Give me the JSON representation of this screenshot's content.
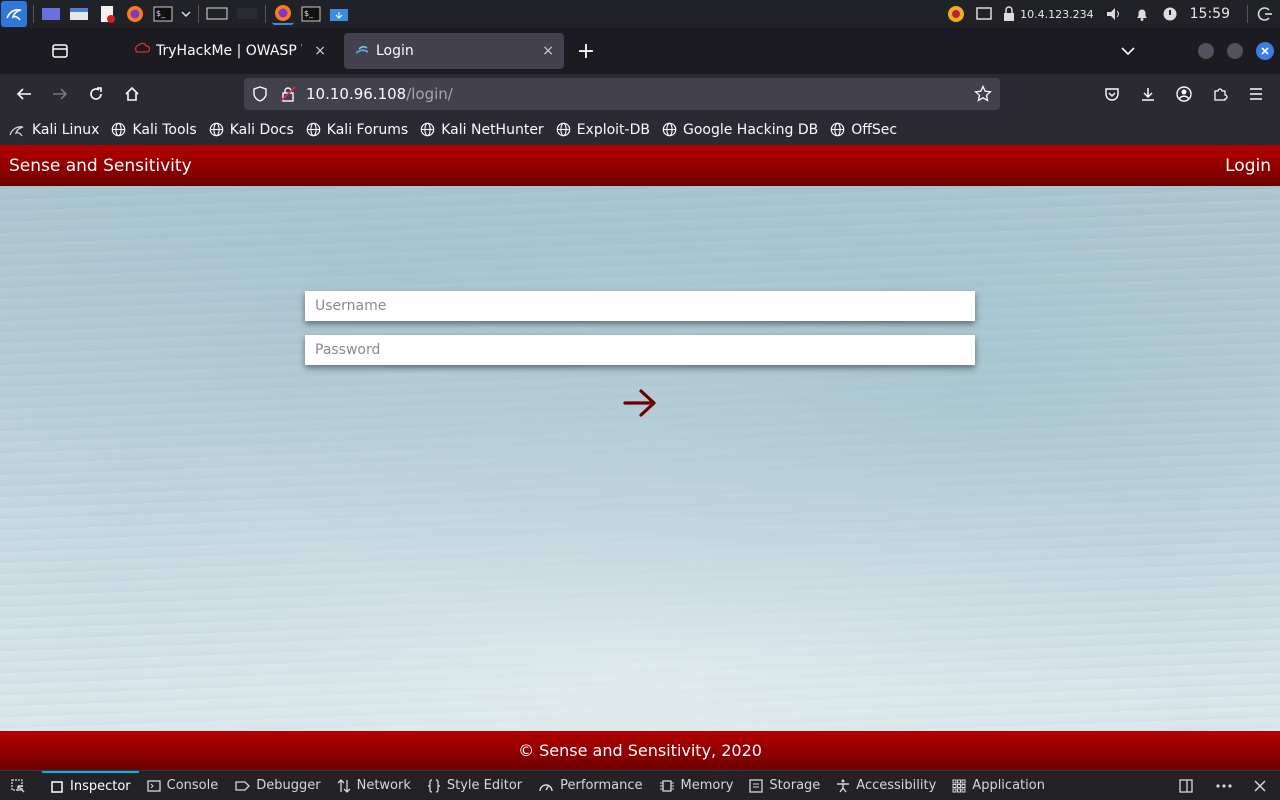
{
  "taskbar": {
    "ip": "10.4.123.234",
    "clock": "15:59"
  },
  "tabs": [
    {
      "label": "TryHackMe | OWASP Top",
      "close": "×"
    },
    {
      "label": "Login",
      "close": "×"
    }
  ],
  "new_tab": "+",
  "url": {
    "host": "10.10.96.108",
    "path": "/login/"
  },
  "bookmarks": [
    "Kali Linux",
    "Kali Tools",
    "Kali Docs",
    "Kali Forums",
    "Kali NetHunter",
    "Exploit-DB",
    "Google Hacking DB",
    "OffSec"
  ],
  "site": {
    "brand": "Sense and Sensitivity",
    "login_link": "Login",
    "username_placeholder": "Username",
    "password_placeholder": "Password",
    "footer": "© Sense and Sensitivity, 2020"
  },
  "devtools": [
    "Inspector",
    "Console",
    "Debugger",
    "Network",
    "Style Editor",
    "Performance",
    "Memory",
    "Storage",
    "Accessibility",
    "Application"
  ],
  "colors": {
    "accent_red": "#a00000",
    "arrow": "#6b0000",
    "devtools_active": "#00b3f4"
  }
}
